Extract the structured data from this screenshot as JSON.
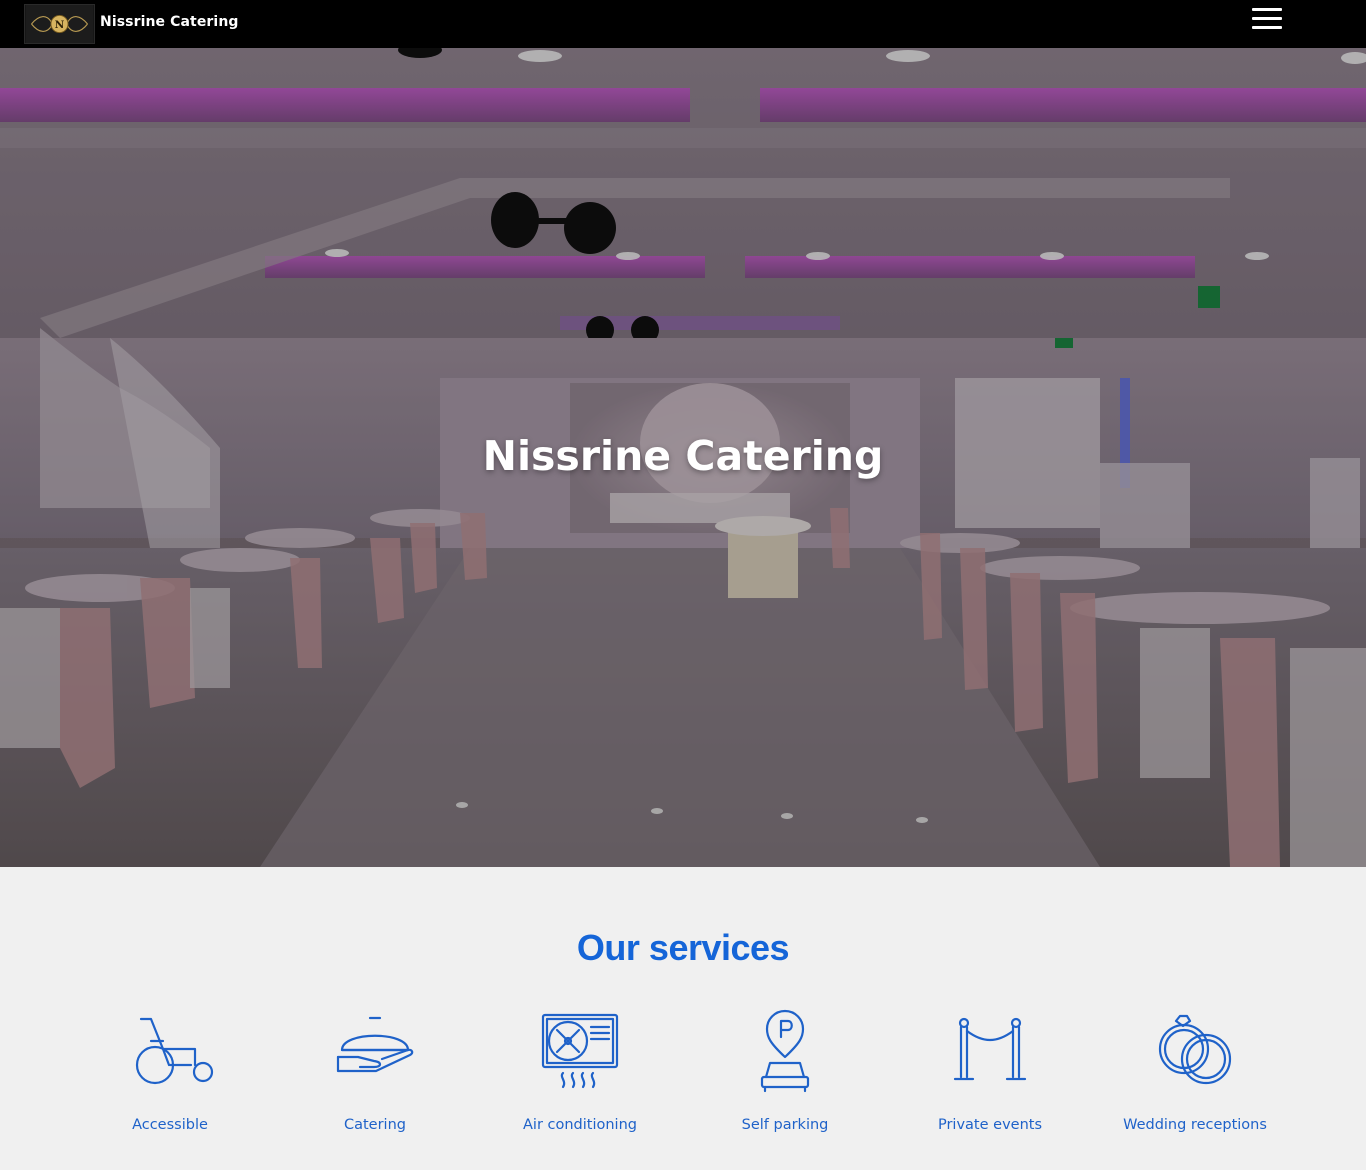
{
  "header": {
    "brand": "Nissrine Catering",
    "logo_icon": "nissrine-logo-icon",
    "menu_icon": "hamburger-menu-icon"
  },
  "hero": {
    "title": "Nissrine Catering"
  },
  "services": {
    "title": "Our services",
    "items": [
      {
        "label": "Accessible",
        "icon": "wheelchair-icon"
      },
      {
        "label": "Catering",
        "icon": "cloche-serving-icon"
      },
      {
        "label": "Air conditioning",
        "icon": "air-conditioner-icon"
      },
      {
        "label": "Self parking",
        "icon": "parking-icon"
      },
      {
        "label": "Private events",
        "icon": "rope-barrier-icon"
      },
      {
        "label": "Wedding receptions",
        "icon": "wedding-rings-icon"
      }
    ]
  },
  "colors": {
    "accent": "#1565d8",
    "topbar": "#000000",
    "background": "#f0f0f0"
  }
}
